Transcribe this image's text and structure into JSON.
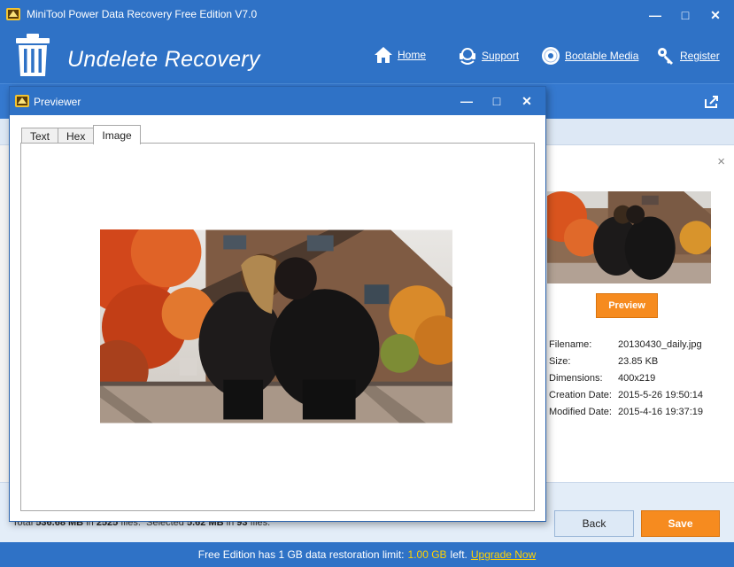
{
  "window": {
    "title": "MiniTool Power Data Recovery Free Edition V7.0",
    "controls": {
      "minimize": "—",
      "maximize": "□",
      "close": "✕"
    }
  },
  "header": {
    "title": "Undelete Recovery",
    "icon": "trash-can-icon",
    "nav": [
      {
        "label": "Home",
        "icon": "house-icon"
      },
      {
        "label": "Support",
        "icon": "headset-icon"
      },
      {
        "label": "Bootable Media",
        "icon": "disc-icon"
      },
      {
        "label": "Register",
        "icon": "key-icon"
      }
    ]
  },
  "previewer": {
    "title": "Previewer",
    "controls": {
      "minimize": "—",
      "maximize": "□",
      "close": "✕"
    },
    "tabs": [
      {
        "label": "Text",
        "active": false
      },
      {
        "label": "Hex",
        "active": false
      },
      {
        "label": "Image",
        "active": true
      }
    ]
  },
  "details": {
    "close": "×",
    "preview_button": "Preview",
    "properties": [
      {
        "key": "Filename:",
        "value": "20130430_daily.jpg"
      },
      {
        "key": "Size:",
        "value": "23.85 KB"
      },
      {
        "key": "Dimensions:",
        "value": "400x219"
      },
      {
        "key": "Creation Date:",
        "value": "2015-5-26 19:50:14"
      },
      {
        "key": "Modified Date:",
        "value": "2015-4-16 19:37:19"
      }
    ]
  },
  "totals": {
    "total_label": "Total",
    "total_size": "536.68 MB",
    "in_label": "in",
    "total_files": "2525",
    "files_label": "files.",
    "selected_label": "Selected",
    "selected_size": "5.62 MB",
    "in_label2": "in",
    "selected_files": "93",
    "files_label2": "files."
  },
  "buttons": {
    "back": "Back",
    "save": "Save"
  },
  "status": {
    "prefix": "Free Edition has 1 GB data restoration limit:",
    "remaining": "1.00 GB",
    "suffix": "left.",
    "upgrade_link": "Upgrade Now"
  },
  "colors": {
    "brand_blue": "#2f72c6",
    "accent_orange": "#f68b1f",
    "highlight_yellow": "#ffd200"
  }
}
